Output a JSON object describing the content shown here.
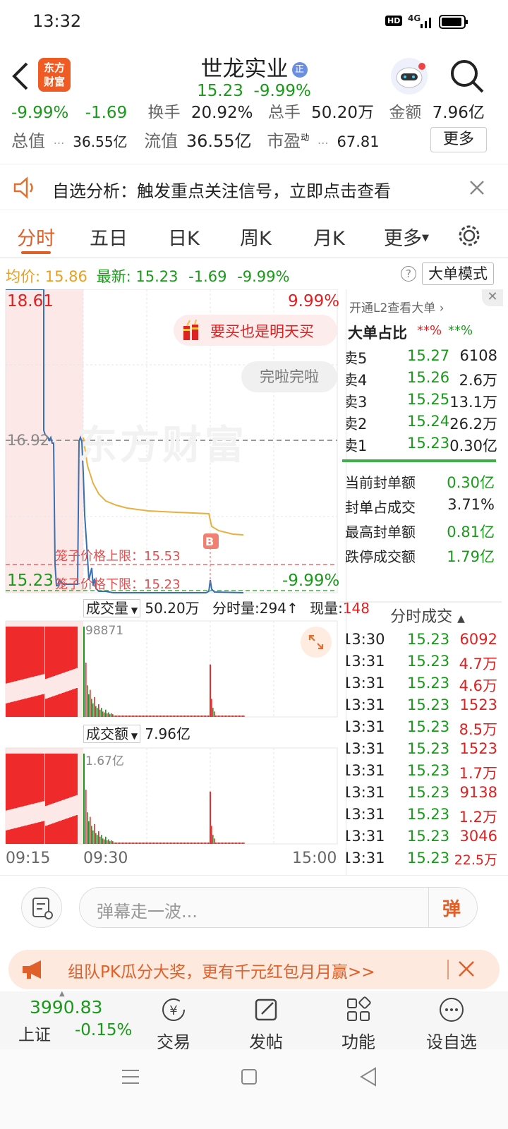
{
  "status": {
    "time": "13:32",
    "hd": "HD",
    "net": "4G"
  },
  "header": {
    "logo_text": "东方\n财富",
    "stock_name": "世龙实业",
    "badge": "正",
    "price": "15.23",
    "change_pct": "-9.99%"
  },
  "quotes": {
    "row1": {
      "pct": "-9.99%",
      "chg": "-1.69",
      "turnover_label": "换手",
      "turnover_val": "20.92%",
      "vol_label": "总手",
      "vol_val": "50.20万",
      "amount_label": "金额",
      "amount_val": "7.96亿"
    },
    "row2": {
      "mcap_label": "总值",
      "mcap_val": "36.55亿",
      "float_label": "流值",
      "float_val": "36.55亿",
      "pe_label": "市盈",
      "pe_sup": "动",
      "pe_val": "67.81",
      "more": "更多"
    }
  },
  "notice": {
    "text": "自选分析：触发重点关注信号，立即点击查看"
  },
  "tabs": [
    "分时",
    "五日",
    "日K",
    "周K",
    "月K",
    "更多"
  ],
  "infoline": {
    "avg_label": "均价:",
    "avg_val": "15.86",
    "last_label": "最新:",
    "last_val": "15.23",
    "chg": "-1.69",
    "pct": "-9.99%",
    "mode_btn": "大单模式"
  },
  "chart": {
    "price_high": "18.61",
    "pct_high": "9.99%",
    "price_mid": "16.92",
    "price_low": "15.23",
    "pct_low": "-9.99%",
    "promo_bubble": "要买也是明天买",
    "gray_bubble": "完啦完啦",
    "cage_upper": "笼子价格上限：15.53",
    "cage_lower": "笼子价格下限：15.23",
    "watermark": "东方财富",
    "b_marker": "B",
    "vol_label": "成交量",
    "vol_total": "50.20万",
    "vol_bar_label": "分时量:294",
    "vol_now_label": "现量:",
    "vol_now": "148",
    "vol_max": "98871",
    "amt_label": "成交额",
    "amt_total": "7.96亿",
    "amt_max": "1.67亿",
    "time_start": "09:15",
    "time_open": "09:30",
    "time_end": "15:00"
  },
  "orderbook": {
    "l2_link": "开通L2查看大单",
    "big_ratio_label": "大单占比",
    "big_ratio_red": "**%",
    "big_ratio_green": "**%",
    "asks": [
      {
        "label": "卖5",
        "price": "15.27",
        "vol": "6108"
      },
      {
        "label": "卖4",
        "price": "15.26",
        "vol": "2.6万"
      },
      {
        "label": "卖3",
        "price": "15.25",
        "vol": "13.1万"
      },
      {
        "label": "卖2",
        "price": "15.24",
        "vol": "26.2万"
      },
      {
        "label": "卖1",
        "price": "15.23",
        "vol": "0.30亿"
      }
    ],
    "seal": [
      {
        "label": "当前封单额",
        "val": "0.30亿"
      },
      {
        "label": "封单占成交",
        "val": "3.71%"
      },
      {
        "label": "最高封单额",
        "val": "0.81亿"
      },
      {
        "label": "跌停成交额",
        "val": "1.79亿"
      }
    ]
  },
  "ticks": {
    "title": "分时成交",
    "rows": [
      {
        "t": "13:30",
        "p": "15.23",
        "v": "6092"
      },
      {
        "t": "13:31",
        "p": "15.23",
        "v": "4.7万"
      },
      {
        "t": "13:31",
        "p": "15.23",
        "v": "4.6万"
      },
      {
        "t": "13:31",
        "p": "15.23",
        "v": "1523"
      },
      {
        "t": "13:31",
        "p": "15.23",
        "v": "8.5万"
      },
      {
        "t": "13:31",
        "p": "15.23",
        "v": "1523"
      },
      {
        "t": "13:31",
        "p": "15.23",
        "v": "1.7万"
      },
      {
        "t": "13:31",
        "p": "15.23",
        "v": "9138"
      },
      {
        "t": "13:31",
        "p": "15.23",
        "v": "1.2万"
      },
      {
        "t": "13:31",
        "p": "15.23",
        "v": "3046"
      },
      {
        "t": "13:31",
        "p": "15.23",
        "v": "22.5万"
      }
    ]
  },
  "comment": {
    "placeholder": "弹幕走一波...",
    "btn": "弹"
  },
  "promo": {
    "text": "组队PK瓜分大奖，更有千元红包月月赢>>"
  },
  "nav": {
    "index_val": "3990.83",
    "index_name": "上证",
    "index_pct": "-0.15%",
    "items": [
      "交易",
      "发帖",
      "功能",
      "设自选"
    ]
  }
}
